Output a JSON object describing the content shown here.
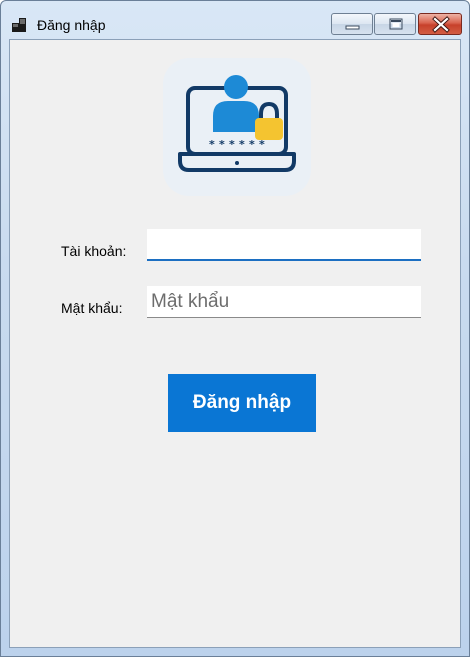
{
  "window": {
    "title": "Đăng nhập",
    "icon": "app-form-icon",
    "controls": [
      "minimize-icon",
      "maximize-icon",
      "close-icon"
    ]
  },
  "logo": {
    "icon": "user-laptop-lock-icon",
    "accent_blue": "#1d8ad6",
    "lock_yellow": "#f4c430",
    "outline_navy": "#123a66"
  },
  "form": {
    "username": {
      "label": "Tài khoản:",
      "value": "",
      "placeholder": ""
    },
    "password": {
      "label": "Mật khẩu:",
      "value": "",
      "placeholder": "Mật khẩu"
    }
  },
  "login_button": {
    "label": "Đăng nhập",
    "color": "#0a76d4"
  }
}
